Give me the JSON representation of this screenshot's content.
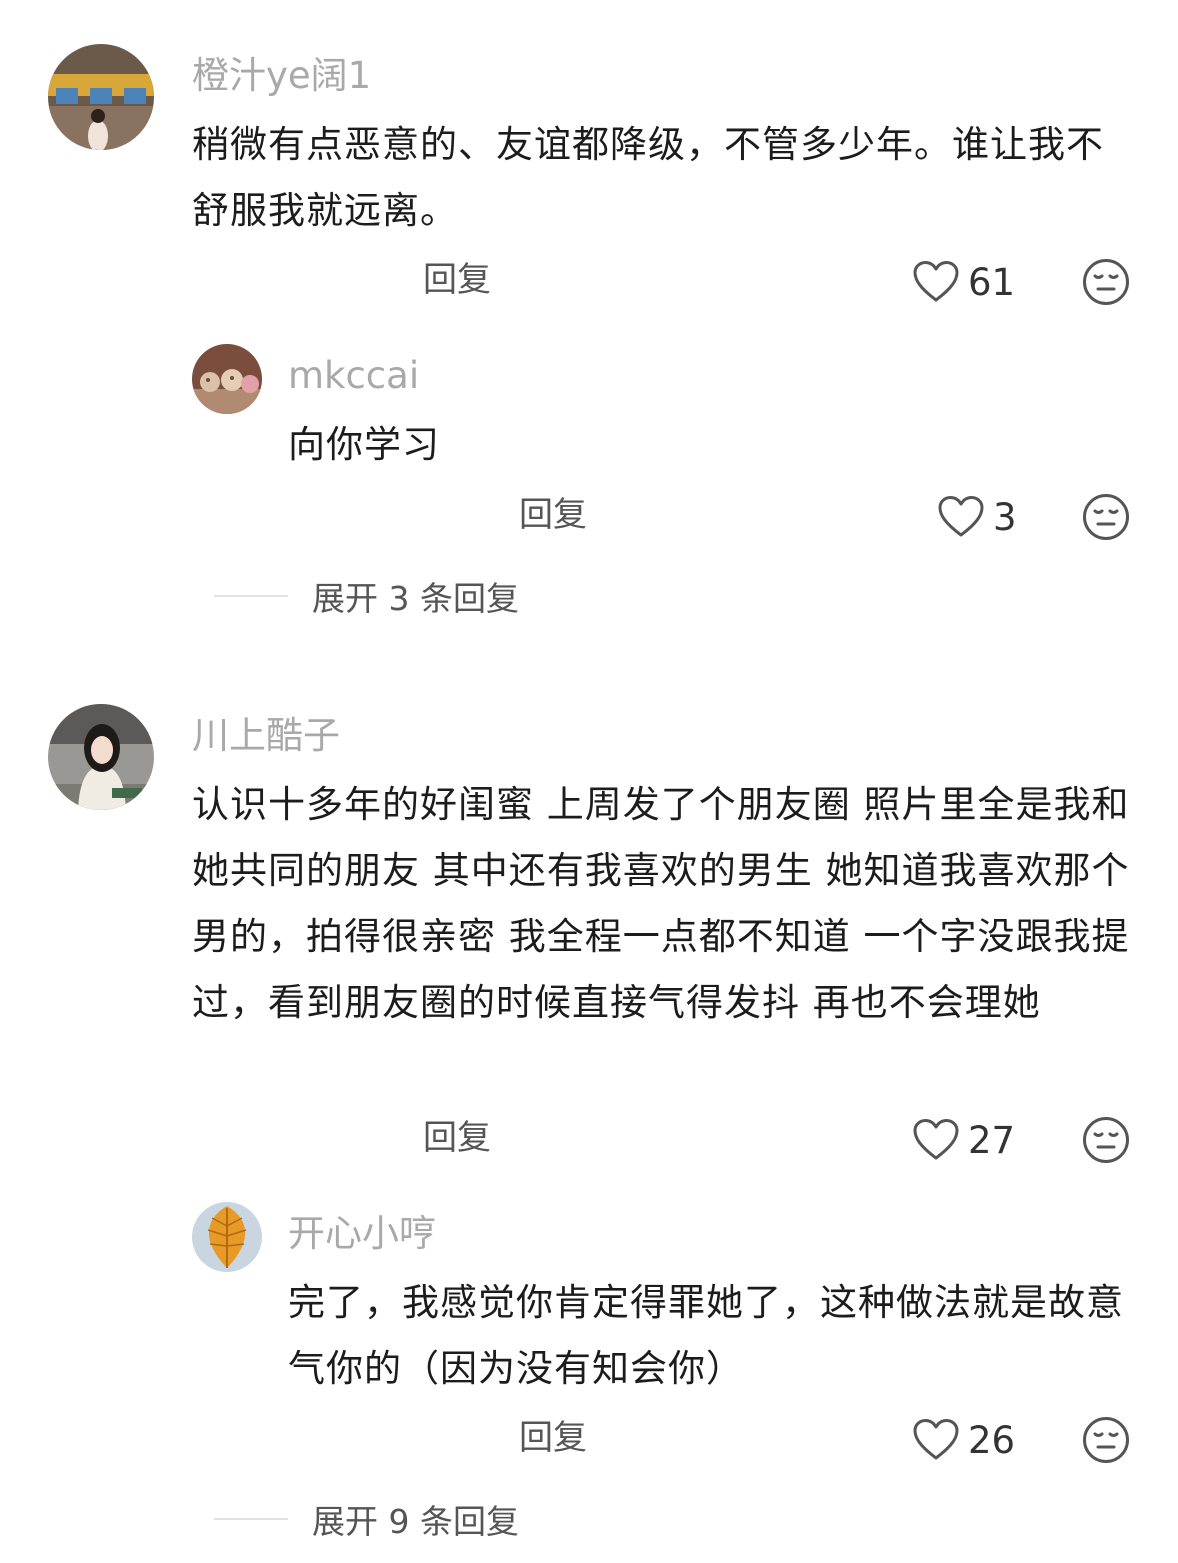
{
  "comments": [
    {
      "username": "橙汁ye阔1",
      "content": "稍微有点恶意的、友谊都降级，不管多少年。谁让我不舒服我就远离。",
      "reply_label": "回复",
      "likes": "61",
      "avatar_icon": "user-avatar",
      "like_icon": "heart-outline-icon",
      "dislike_icon": "meh-face-icon",
      "replies": [
        {
          "username": "mkccai",
          "content": "向你学习",
          "reply_label": "回复",
          "likes": "3",
          "avatar_icon": "user-avatar"
        }
      ],
      "expand_label": "展开 3 条回复"
    },
    {
      "username": "川上酷子",
      "content": "认识十多年的好闺蜜 上周发了个朋友圈 照片里全是我和她共同的朋友 其中还有我喜欢的男生 她知道我喜欢那个男的，拍得很亲密 我全程一点都不知道 一个字没跟我提过，看到朋友圈的时候直接气得发抖 再也不会理她",
      "reply_label": "回复",
      "likes": "27",
      "avatar_icon": "user-avatar",
      "replies": [
        {
          "username": "开心小哼",
          "content": "完了，我感觉你肯定得罪她了，这种做法就是故意气你的（因为没有知会你）",
          "reply_label": "回复",
          "likes": "26",
          "avatar_icon": "user-avatar"
        }
      ],
      "expand_label": "展开 9 条回复"
    }
  ],
  "colors": {
    "username": "#a9a9a9",
    "content": "#1c1c1c",
    "secondary": "#555555",
    "icon": "#555555"
  }
}
